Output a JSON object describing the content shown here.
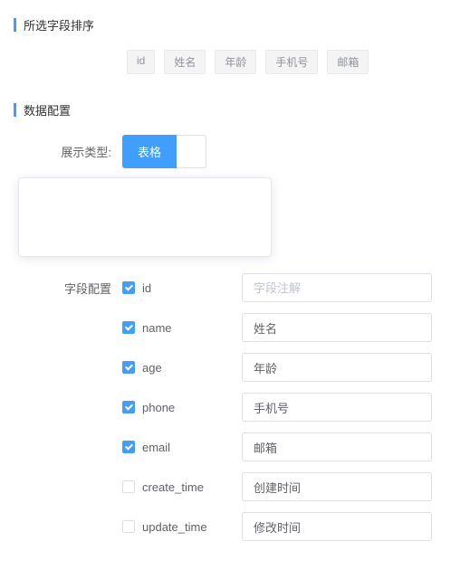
{
  "section1": {
    "title": "所选字段排序"
  },
  "tags": [
    "id",
    "姓名",
    "年龄",
    "手机号",
    "邮箱"
  ],
  "section2": {
    "title": "数据配置"
  },
  "displayType": {
    "label": "展示类型:",
    "options": [
      "表格",
      ""
    ],
    "activeIndex": 0
  },
  "fieldConfig": {
    "label": "字段配置",
    "placeholder": "字段注解",
    "rows": [
      {
        "checked": true,
        "name": "id",
        "value": ""
      },
      {
        "checked": true,
        "name": "name",
        "value": "姓名"
      },
      {
        "checked": true,
        "name": "age",
        "value": "年龄"
      },
      {
        "checked": true,
        "name": "phone",
        "value": "手机号"
      },
      {
        "checked": true,
        "name": "email",
        "value": "邮箱"
      },
      {
        "checked": false,
        "name": "create_time",
        "value": "创建时间"
      },
      {
        "checked": false,
        "name": "update_time",
        "value": "修改时间"
      }
    ]
  }
}
